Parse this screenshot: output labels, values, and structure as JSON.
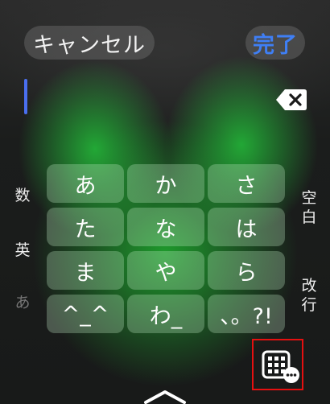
{
  "header": {
    "cancel_label": "キャンセル",
    "done_label": "完了"
  },
  "side": {
    "num": "数",
    "eng": "英",
    "hira": "あ",
    "space": "空白",
    "return": "改行"
  },
  "keys": [
    "あ",
    "か",
    "さ",
    "た",
    "な",
    "は",
    "ま",
    "や",
    "ら",
    "^_^",
    "わ_",
    "、。?!"
  ],
  "colors": {
    "accent": "#3f7ff5",
    "cursor": "#4a6ff0",
    "highlight": "#e51010"
  },
  "icons": {
    "backspace": "backspace-icon",
    "keyboard_switch": "keyboard-grid-icon",
    "dismiss": "chevron-up-icon"
  }
}
